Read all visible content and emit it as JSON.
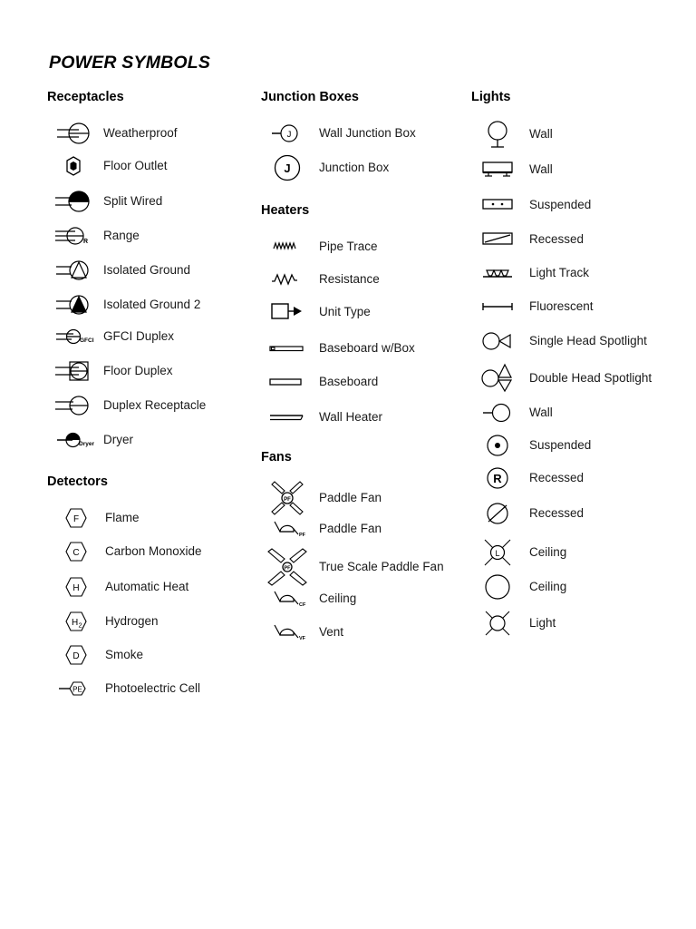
{
  "document": {
    "title": "POWER SYMBOLS",
    "background_color": "#ffffff",
    "ink_color": "#000000"
  },
  "columns": [
    {
      "id": "column-left",
      "sections": [
        {
          "id": "receptacles",
          "heading": "Receptacles",
          "items": [
            {
              "symbol": "weatherproof-receptacle",
              "label": "Weatherproof"
            },
            {
              "symbol": "floor-outlet",
              "label": "Floor Outlet"
            },
            {
              "symbol": "split-wired-receptacle",
              "label": "Split Wired"
            },
            {
              "symbol": "range-receptacle",
              "label": "Range",
              "symbol_text": "R"
            },
            {
              "symbol": "isolated-ground-receptacle",
              "label": "Isolated Ground"
            },
            {
              "symbol": "isolated-ground-2-receptacle",
              "label": "Isolated Ground 2"
            },
            {
              "symbol": "gfci-duplex-receptacle",
              "label": "GFCI Duplex",
              "symbol_text": "GFCI"
            },
            {
              "symbol": "floor-duplex-receptacle",
              "label": "Floor Duplex"
            },
            {
              "symbol": "duplex-receptacle",
              "label": "Duplex Receptacle"
            },
            {
              "symbol": "dryer-receptacle",
              "label": "Dryer",
              "symbol_text": "Dryer"
            }
          ]
        },
        {
          "id": "detectors",
          "heading": "Detectors",
          "items": [
            {
              "symbol": "flame-detector",
              "label": "Flame",
              "symbol_text": "F"
            },
            {
              "symbol": "carbon-monoxide-detector",
              "label": "Carbon Monoxide",
              "symbol_text": "C"
            },
            {
              "symbol": "automatic-heat-detector",
              "label": "Automatic Heat",
              "symbol_text": "H"
            },
            {
              "symbol": "hydrogen-detector",
              "label": "Hydrogen",
              "symbol_text": "H2"
            },
            {
              "symbol": "smoke-detector",
              "label": "Smoke",
              "symbol_text": "D"
            },
            {
              "symbol": "photoelectric-cell-detector",
              "label": "Photoelectric Cell",
              "symbol_text": "PE"
            }
          ]
        }
      ]
    },
    {
      "id": "column-middle",
      "sections": [
        {
          "id": "junction-boxes",
          "heading": "Junction Boxes",
          "items": [
            {
              "symbol": "wall-junction-box",
              "label": "Wall Junction Box",
              "symbol_text": "J"
            },
            {
              "symbol": "junction-box",
              "label": "Junction Box",
              "symbol_text": "J"
            }
          ]
        },
        {
          "id": "heaters",
          "heading": "Heaters",
          "items": [
            {
              "symbol": "pipe-trace-heater",
              "label": "Pipe Trace"
            },
            {
              "symbol": "resistance-heater",
              "label": "Resistance"
            },
            {
              "symbol": "unit-type-heater",
              "label": "Unit Type"
            },
            {
              "symbol": "baseboard-with-box-heater",
              "label": "Baseboard w/Box"
            },
            {
              "symbol": "baseboard-heater",
              "label": "Baseboard"
            },
            {
              "symbol": "wall-heater",
              "label": "Wall Heater"
            }
          ]
        },
        {
          "id": "fans",
          "heading": "Fans",
          "items": [
            {
              "symbol": "paddle-fan-plan",
              "label": "Paddle Fan",
              "symbol_text": "PF"
            },
            {
              "symbol": "paddle-fan-elevation",
              "label": "Paddle Fan",
              "symbol_text": "PF"
            },
            {
              "symbol": "true-scale-paddle-fan",
              "label": "True Scale Paddle Fan",
              "symbol_text": "PF"
            },
            {
              "symbol": "ceiling-fan-elevation",
              "label": "Ceiling",
              "symbol_text": "CF"
            },
            {
              "symbol": "vent-fan-elevation",
              "label": "Vent",
              "symbol_text": "VF"
            }
          ]
        }
      ]
    },
    {
      "id": "column-right",
      "sections": [
        {
          "id": "lights",
          "heading": "Lights",
          "items": [
            {
              "symbol": "wall-light-globe",
              "label": "Wall"
            },
            {
              "symbol": "wall-light-box",
              "label": "Wall"
            },
            {
              "symbol": "suspended-light-bar",
              "label": "Suspended"
            },
            {
              "symbol": "recessed-light-rect",
              "label": "Recessed"
            },
            {
              "symbol": "light-track",
              "label": "Light Track"
            },
            {
              "symbol": "fluorescent-light",
              "label": "Fluorescent"
            },
            {
              "symbol": "single-head-spotlight",
              "label": "Single Head Spotlight"
            },
            {
              "symbol": "double-head-spotlight",
              "label": "Double Head Spotlight"
            },
            {
              "symbol": "wall-light-circle",
              "label": "Wall"
            },
            {
              "symbol": "suspended-light-circle",
              "label": "Suspended"
            },
            {
              "symbol": "recessed-light-r",
              "label": "Recessed",
              "symbol_text": "R"
            },
            {
              "symbol": "recessed-light-slash",
              "label": "Recessed"
            },
            {
              "symbol": "ceiling-light-l",
              "label": "Ceiling",
              "symbol_text": "L"
            },
            {
              "symbol": "ceiling-light-circle",
              "label": "Ceiling"
            },
            {
              "symbol": "light-circle-x",
              "label": "Light"
            }
          ]
        }
      ]
    }
  ]
}
